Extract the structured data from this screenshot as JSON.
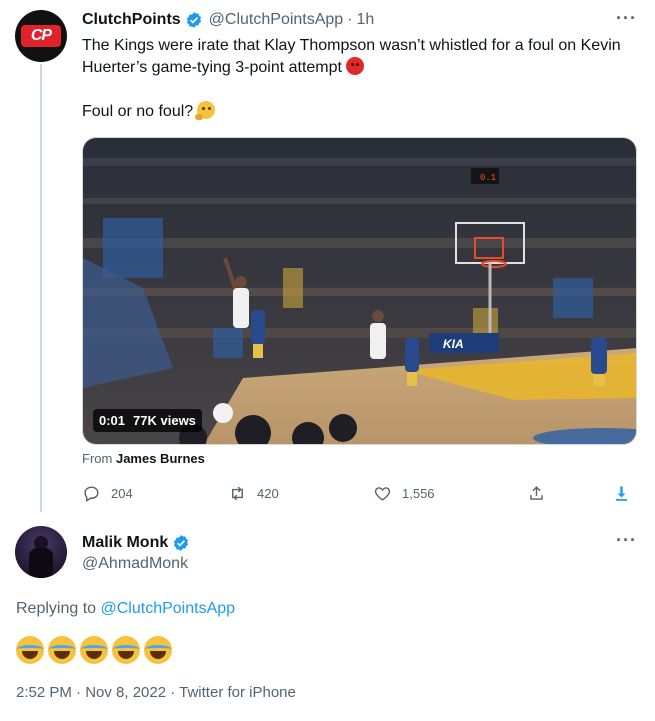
{
  "tweet": {
    "author_name": "ClutchPoints",
    "handle": "@ClutchPointsApp",
    "separator": "·",
    "time_ago": "1h",
    "avatar_text": "CP",
    "text_line1": "The Kings were irate that Klay Thompson wasn’t whistled for a foul on Kevin",
    "text_line2": "Huerter’s game-tying 3-point attempt",
    "text_line3": "Foul or no foul?",
    "video": {
      "time": "0:01",
      "views": "77K views",
      "scoreboard": "0.1",
      "court_sign": "KIA"
    },
    "from_label": "From",
    "from_name": "James Burnes",
    "actions": {
      "replies": "204",
      "retweets": "420",
      "likes": "1,556"
    }
  },
  "reply": {
    "author_name": "Malik Monk",
    "handle": "@AhmadMonk",
    "replying_label": "Replying to",
    "replying_to": "@ClutchPointsApp",
    "emojis": [
      "face-with-tears-of-joy",
      "face-with-tears-of-joy",
      "face-with-tears-of-joy",
      "face-with-tears-of-joy",
      "face-with-tears-of-joy"
    ],
    "timestamp": "2:52 PM · Nov 8, 2022 · Twitter for iPhone"
  },
  "colors": {
    "accent": "#1d9bf0",
    "muted": "#536471",
    "text": "#0f1419",
    "brand_red": "#e0232b"
  },
  "icons": [
    "verified-badge-icon",
    "more-icon",
    "reply-icon",
    "retweet-icon",
    "like-icon",
    "share-icon",
    "download-icon"
  ]
}
